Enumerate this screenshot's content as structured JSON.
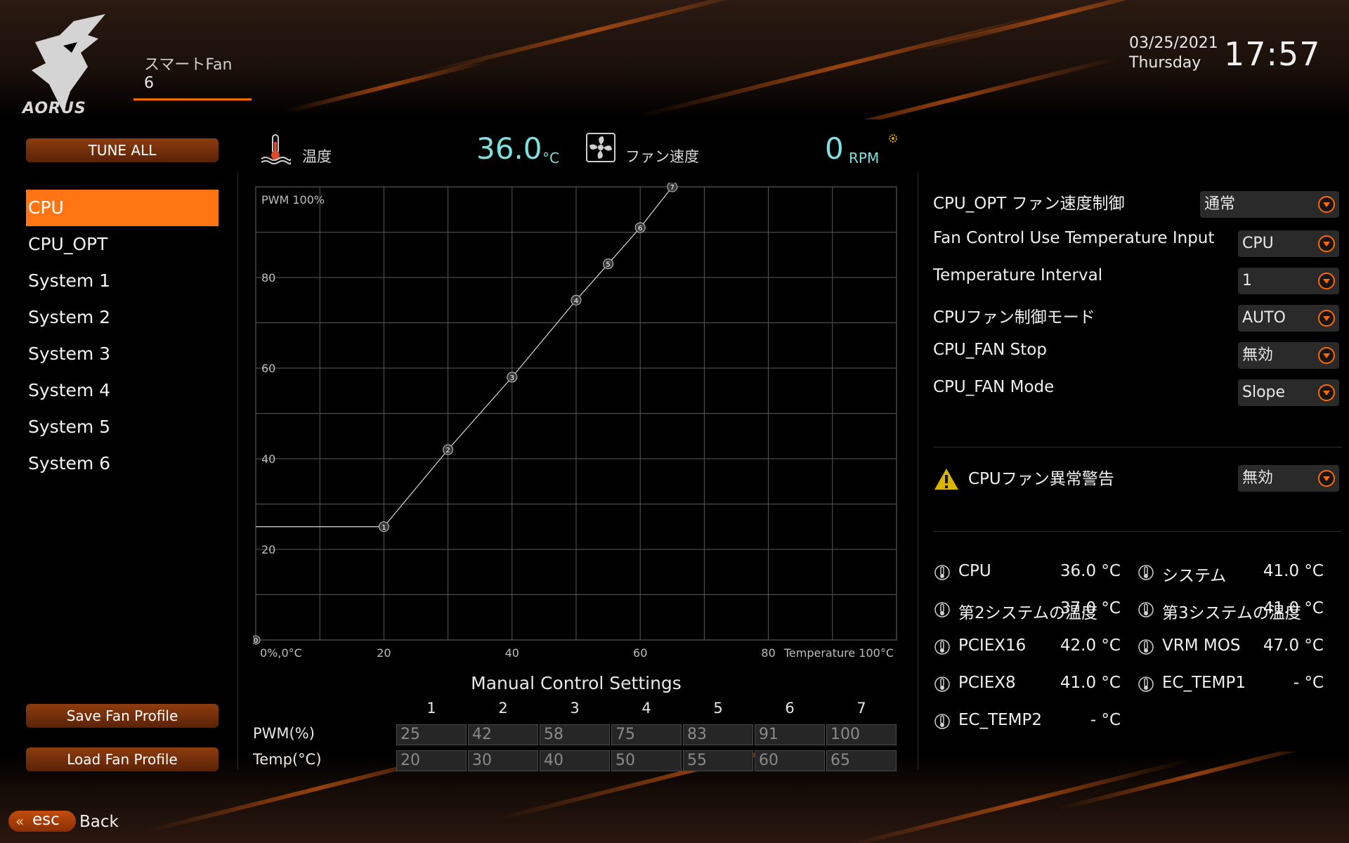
{
  "header": {
    "brand": "AORUS",
    "title": "スマートFan",
    "subtitle": "6",
    "date": "03/25/2021",
    "weekday": "Thursday",
    "time": "17:57"
  },
  "sidebar": {
    "tune_all": "TUNE ALL",
    "items": [
      {
        "label": "CPU",
        "active": true
      },
      {
        "label": "CPU_OPT"
      },
      {
        "label": "System 1"
      },
      {
        "label": "System 2"
      },
      {
        "label": "System 3"
      },
      {
        "label": "System 4"
      },
      {
        "label": "System 5"
      },
      {
        "label": "System 6"
      }
    ],
    "save_profile": "Save Fan Profile",
    "load_profile": "Load Fan Profile"
  },
  "status": {
    "temp_label": "温度",
    "temp_value": "36.0",
    "temp_unit": "°C",
    "fan_label": "ファン速度",
    "fan_value": "0",
    "fan_unit": "RPM"
  },
  "chart_data": {
    "type": "line",
    "ylabel": "PWM 100%",
    "xlabel": "Temperature 100°C",
    "origin_label": "0%,0°C",
    "y_ticks": [
      "80",
      "60",
      "40",
      "20"
    ],
    "x_ticks": [
      "20",
      "40",
      "60",
      "80"
    ],
    "x_range": [
      0,
      100
    ],
    "y_range": [
      0,
      100
    ],
    "grid": true,
    "points": [
      {
        "label": "1",
        "temp": 20,
        "pwm": 25
      },
      {
        "label": "2",
        "temp": 30,
        "pwm": 42
      },
      {
        "label": "3",
        "temp": 40,
        "pwm": 58
      },
      {
        "label": "4",
        "temp": 50,
        "pwm": 75
      },
      {
        "label": "5",
        "temp": 55,
        "pwm": 83
      },
      {
        "label": "6",
        "temp": 60,
        "pwm": 91
      },
      {
        "label": "7",
        "temp": 65,
        "pwm": 100
      }
    ],
    "zero_marker": "0"
  },
  "manual": {
    "title": "Manual Control Settings",
    "columns": [
      "1",
      "2",
      "3",
      "4",
      "5",
      "6",
      "7"
    ],
    "pwm_label": "PWM(%)",
    "temp_label": "Temp(°C)",
    "pwm": [
      "25",
      "42",
      "58",
      "75",
      "83",
      "91",
      "100"
    ],
    "temp": [
      "20",
      "30",
      "40",
      "50",
      "55",
      "60",
      "65"
    ]
  },
  "settings": [
    {
      "label": "CPU_OPT ファン速度制御",
      "value": "通常"
    },
    {
      "label": "Fan Control Use Temperature Input",
      "value": "CPU"
    },
    {
      "label": "Temperature Interval",
      "value": "1"
    },
    {
      "label": "CPUファン制御モード",
      "value": "AUTO"
    },
    {
      "label": "CPU_FAN Stop",
      "value": "無効"
    },
    {
      "label": "CPU_FAN Mode",
      "value": "Slope"
    }
  ],
  "warning": {
    "label": "CPUファン異常警告",
    "value": "無効"
  },
  "sensors": [
    {
      "name": "CPU",
      "value": "36.0 °C"
    },
    {
      "name": "システム",
      "value": "41.0 °C"
    },
    {
      "name": "第2システムの温度",
      "value": "37.0 °C"
    },
    {
      "name": "第3システムの温度",
      "value": "41.0 °C"
    },
    {
      "name": "PCIEX16",
      "value": "42.0 °C"
    },
    {
      "name": "VRM MOS",
      "value": "47.0 °C"
    },
    {
      "name": "PCIEX8",
      "value": "41.0 °C"
    },
    {
      "name": "EC_TEMP1",
      "value": "- °C"
    },
    {
      "name": "EC_TEMP2",
      "value": "- °C"
    }
  ],
  "footer": {
    "esc": "esc",
    "back": "Back"
  },
  "colors": {
    "accent": "#ff7514",
    "value_cyan": "#7fe0df"
  }
}
